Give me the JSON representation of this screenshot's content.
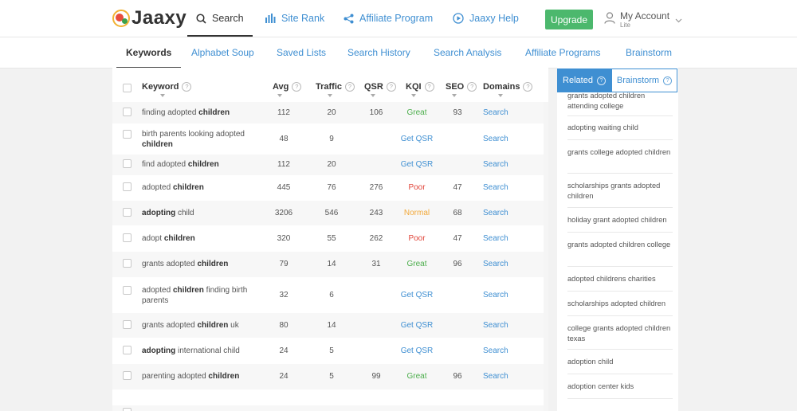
{
  "brand": {
    "name": "Jaaxy"
  },
  "topnav": {
    "search": "Search",
    "site_rank": "Site Rank",
    "affiliate_program": "Affiliate Program",
    "help": "Jaaxy Help"
  },
  "upgrade_label": "Upgrade",
  "account": {
    "name": "My Account",
    "plan": "Lite"
  },
  "subnav": [
    "Keywords",
    "Alphabet Soup",
    "Saved Lists",
    "Search History",
    "Search Analysis",
    "Affiliate Programs",
    "Brainstorm"
  ],
  "table": {
    "headers": {
      "keyword": "Keyword",
      "avg": "Avg",
      "traffic": "Traffic",
      "qsr": "QSR",
      "kqi": "KQI",
      "seo": "SEO",
      "domains": "Domains"
    },
    "rows": [
      {
        "pre": "finding adopted ",
        "bold": "children",
        "post": "",
        "avg": "112",
        "traffic": "20",
        "qsr": "106",
        "kqi": "Great",
        "seo": "93",
        "domains": "Search"
      },
      {
        "pre": "birth parents looking adopted ",
        "bold": "children",
        "post": "",
        "avg": "48",
        "traffic": "9",
        "qsr": "",
        "kqi": "Get QSR",
        "seo": "",
        "domains": "Search"
      },
      {
        "pre": "find adopted ",
        "bold": "children",
        "post": "",
        "avg": "112",
        "traffic": "20",
        "qsr": "",
        "kqi": "Get QSR",
        "seo": "",
        "domains": "Search"
      },
      {
        "pre": "adopted ",
        "bold": "children",
        "post": "",
        "avg": "445",
        "traffic": "76",
        "qsr": "276",
        "kqi": "Poor",
        "seo": "47",
        "domains": "Search"
      },
      {
        "pre": "",
        "bold": "adopting",
        "post": " child",
        "avg": "3206",
        "traffic": "546",
        "qsr": "243",
        "kqi": "Normal",
        "seo": "68",
        "domains": "Search"
      },
      {
        "pre": "adopt ",
        "bold": "children",
        "post": "",
        "avg": "320",
        "traffic": "55",
        "qsr": "262",
        "kqi": "Poor",
        "seo": "47",
        "domains": "Search"
      },
      {
        "pre": "grants adopted ",
        "bold": "children",
        "post": "",
        "avg": "79",
        "traffic": "14",
        "qsr": "31",
        "kqi": "Great",
        "seo": "96",
        "domains": "Search"
      },
      {
        "pre": "adopted ",
        "bold": "children",
        "post": " finding birth parents",
        "avg": "32",
        "traffic": "6",
        "qsr": "",
        "kqi": "Get QSR",
        "seo": "",
        "domains": "Search"
      },
      {
        "pre": "grants adopted ",
        "bold": "children",
        "post": " uk",
        "avg": "80",
        "traffic": "14",
        "qsr": "",
        "kqi": "Get QSR",
        "seo": "",
        "domains": "Search"
      },
      {
        "pre": "",
        "bold": "adopting",
        "post": " international child",
        "avg": "24",
        "traffic": "5",
        "qsr": "",
        "kqi": "Get QSR",
        "seo": "",
        "domains": "Search"
      },
      {
        "pre": "parenting adopted ",
        "bold": "children",
        "post": "",
        "avg": "24",
        "traffic": "5",
        "qsr": "99",
        "kqi": "Great",
        "seo": "96",
        "domains": "Search"
      }
    ]
  },
  "related": {
    "tab_related": "Related",
    "tab_brainstorm": "Brainstorm",
    "items": [
      "grants adopted children attending college",
      "adopting waiting child",
      "grants college adopted children",
      "scholarships grants adopted children",
      "holiday grant adopted children",
      "grants adopted children college",
      "adopted childrens charities",
      "scholarships adopted children",
      "college grants adopted children texas",
      "adoption child",
      "adoption center kids"
    ]
  }
}
